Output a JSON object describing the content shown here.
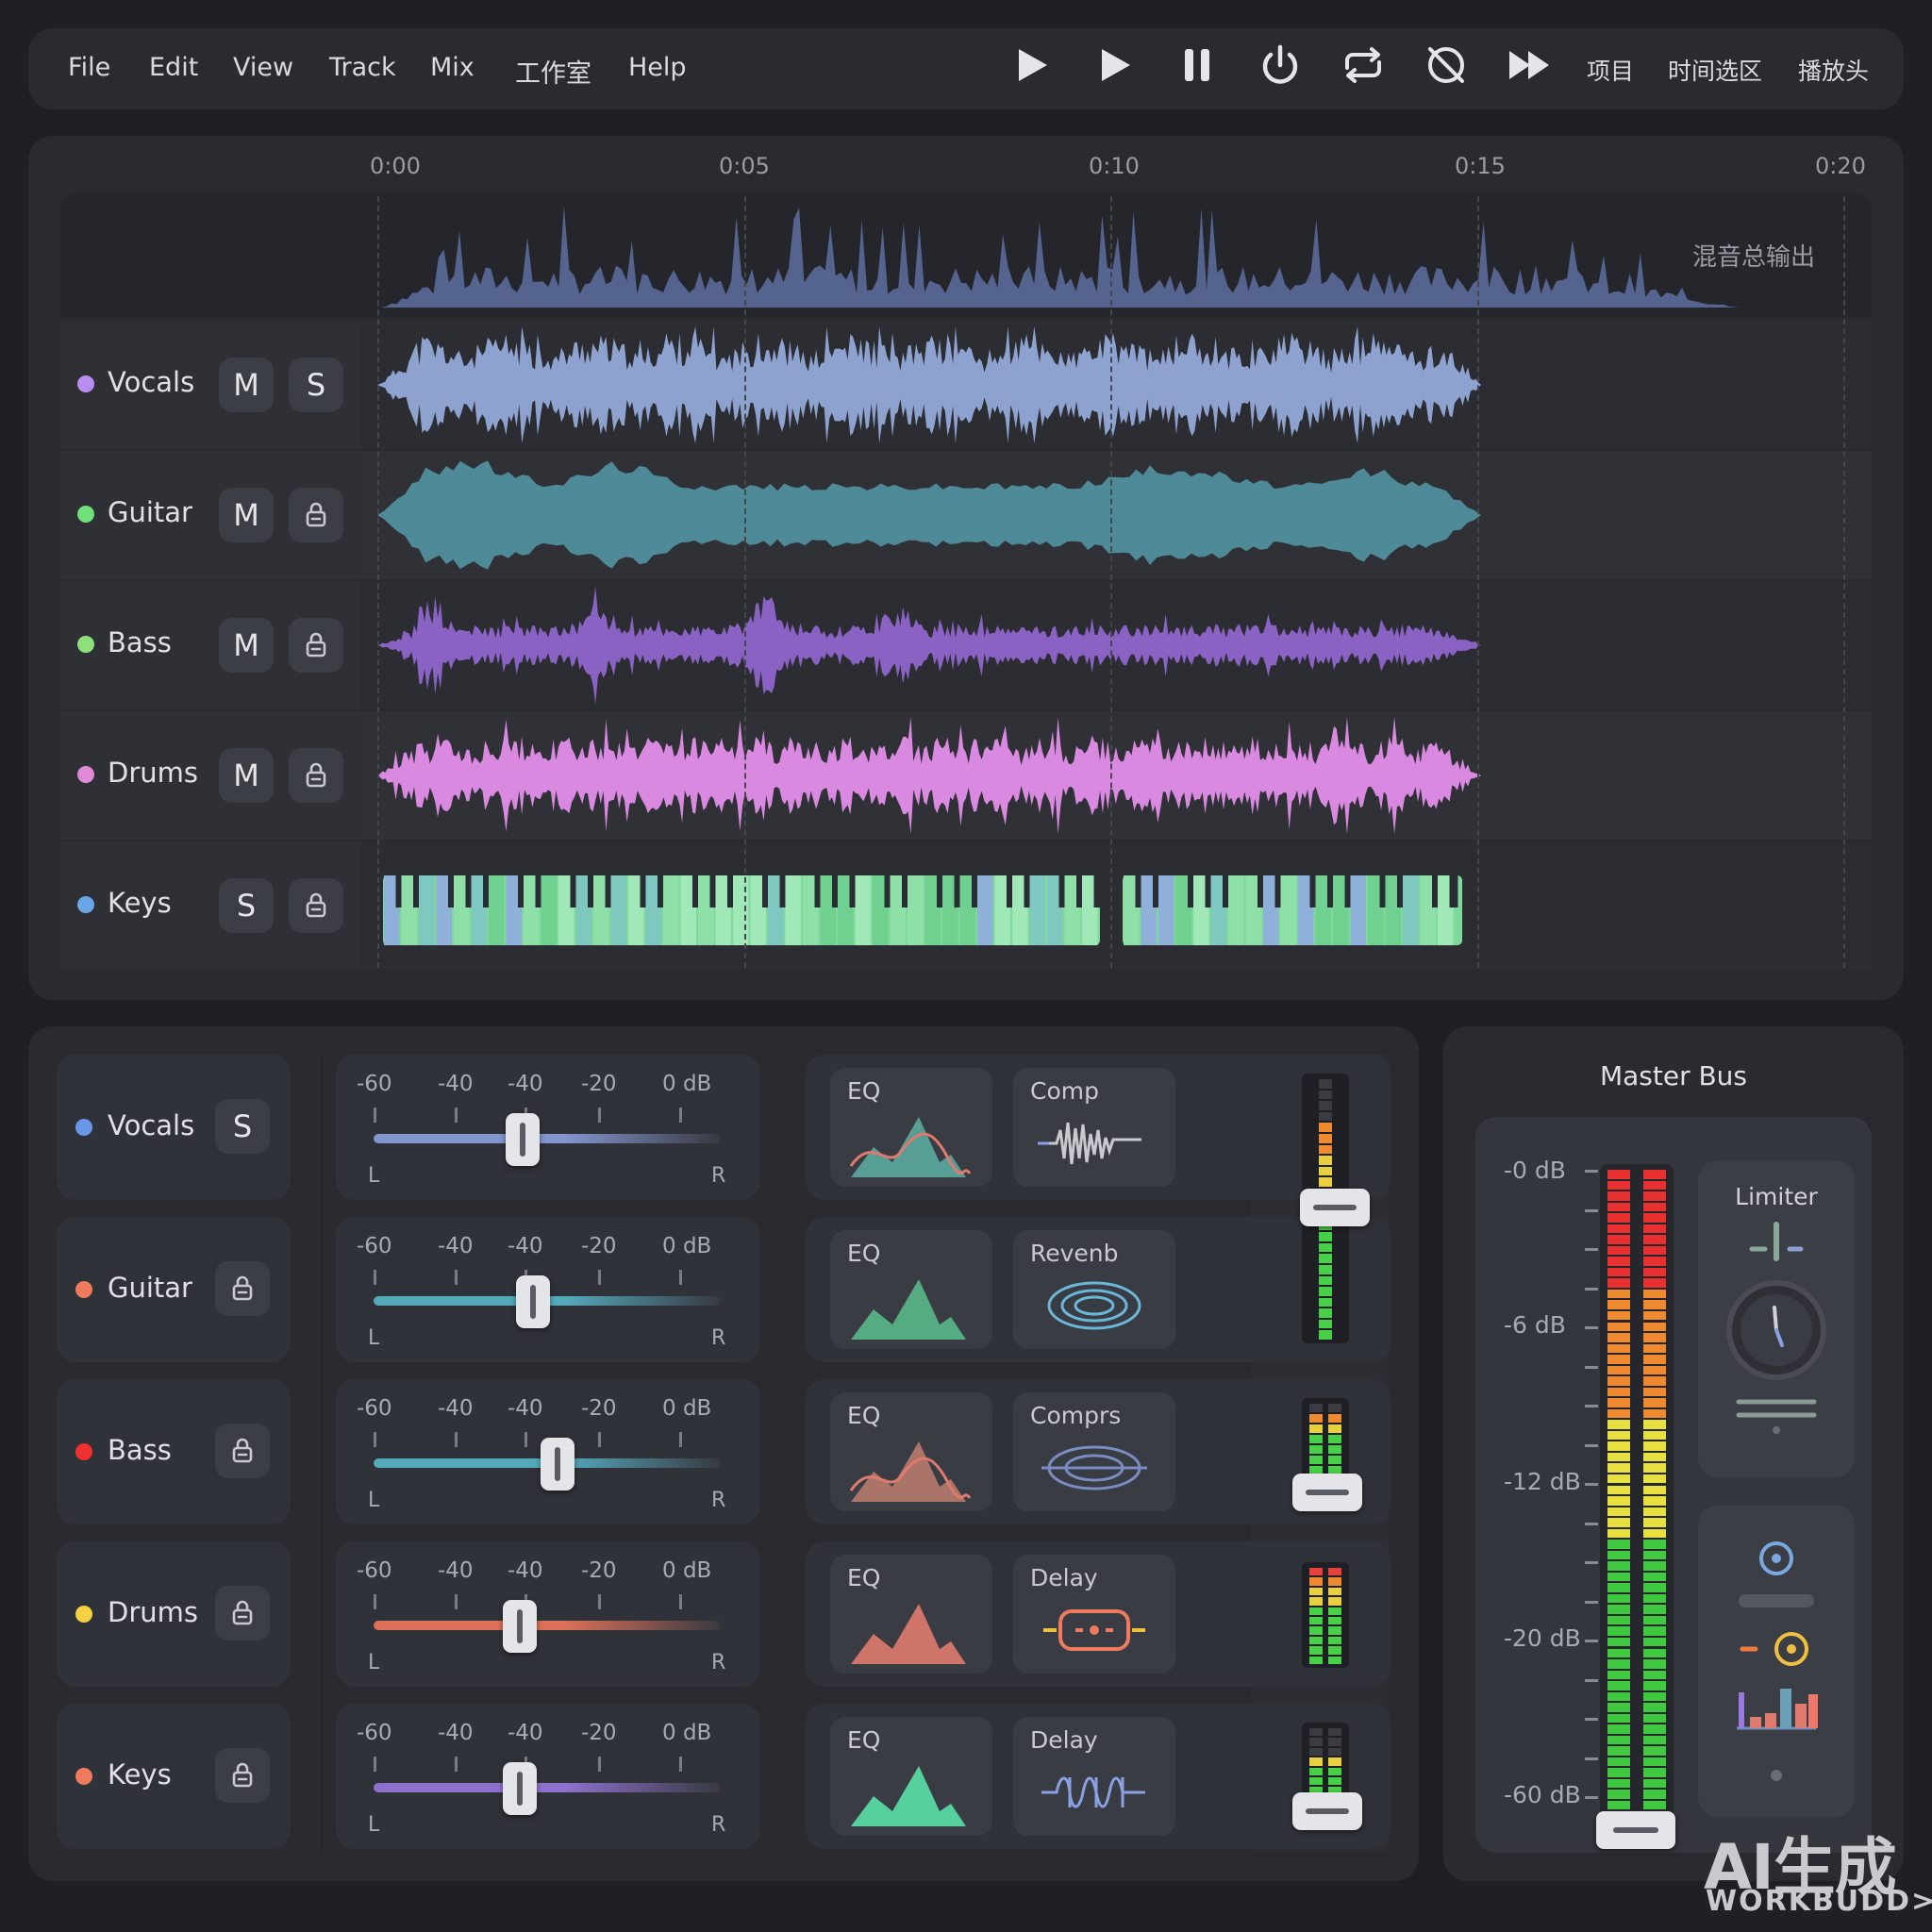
{
  "menu": {
    "items": [
      "File",
      "Edit",
      "View",
      "Track",
      "Mix",
      "工作室",
      "Help"
    ],
    "right_labels": [
      "项目",
      "时间选区",
      "播放头"
    ]
  },
  "transport": {
    "icons": [
      "play-icon",
      "play-icon",
      "pause-icon",
      "power-icon",
      "loop-icon",
      "loop-off-icon",
      "fast-forward-icon"
    ]
  },
  "timeline": {
    "ticks": [
      "0:00",
      "0:05",
      "0:10",
      "0:15",
      "0:20"
    ],
    "master_label": "混音总输出",
    "tracks": [
      {
        "name": "Vocals",
        "color": "#b98ef0",
        "buttons": [
          "M",
          "S"
        ],
        "wave_color": "#8ea2cf"
      },
      {
        "name": "Guitar",
        "color": "#6fe07a",
        "buttons": [
          "M",
          "lock"
        ],
        "wave_color": "#4f8a98"
      },
      {
        "name": "Bass",
        "color": "#8fe07a",
        "buttons": [
          "M",
          "lock"
        ],
        "wave_color": "#8a62c4"
      },
      {
        "name": "Drums",
        "color": "#e08ad9",
        "buttons": [
          "M",
          "lock"
        ],
        "wave_color": "#d98ae0"
      },
      {
        "name": "Keys",
        "color": "#6aa6e8",
        "buttons": [
          "S",
          "lock"
        ],
        "wave_color": "#7fd99a"
      }
    ]
  },
  "mixer": {
    "pan_labels": [
      "-60",
      "-40",
      "-40",
      "-20",
      "0 dB"
    ],
    "left_label": "L",
    "right_label": "R",
    "channels": [
      {
        "name": "Vocals",
        "color": "#6a98e8",
        "button": "S",
        "pan": 0.43,
        "fill_color": "#8ea2e0",
        "fx": [
          {
            "name": "EQ"
          },
          {
            "name": "Comp"
          }
        ]
      },
      {
        "name": "Guitar",
        "color": "#f07a5e",
        "button": "lock",
        "pan": 0.46,
        "fill_color": "#5ab8cc",
        "fx": [
          {
            "name": "EQ"
          },
          {
            "name": "Revenb"
          }
        ]
      },
      {
        "name": "Bass",
        "color": "#ee3030",
        "button": "lock",
        "pan": 0.53,
        "fill_color": "#5ab8cc",
        "fx": [
          {
            "name": "EQ"
          },
          {
            "name": "Comprs"
          }
        ]
      },
      {
        "name": "Drums",
        "color": "#f5d040",
        "button": "lock",
        "pan": 0.42,
        "fill_color": "#f07a5e",
        "fx": [
          {
            "name": "EQ"
          },
          {
            "name": "Delay"
          }
        ]
      },
      {
        "name": "Keys",
        "color": "#f07a5e",
        "button": "lock",
        "pan": 0.42,
        "fill_color": "#9a7ae0",
        "fx": [
          {
            "name": "EQ"
          },
          {
            "name": "Delay"
          }
        ]
      }
    ]
  },
  "master": {
    "title": "Master Bus",
    "db_labels": [
      "-0 dB",
      "-6 dB",
      "-12 dB",
      "-20 dB",
      "-60 dB"
    ],
    "limiter_label": "Limiter"
  },
  "watermark": {
    "main": "AI生成",
    "sub": "WORKBUDD>_"
  }
}
